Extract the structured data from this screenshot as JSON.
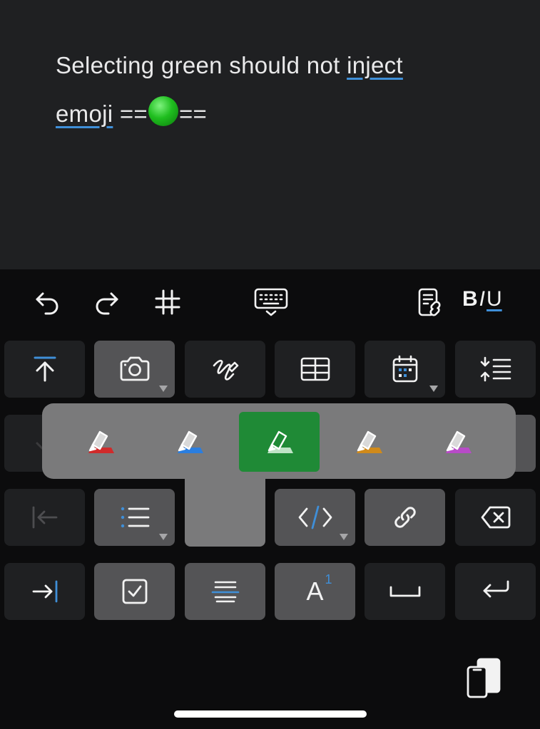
{
  "editor": {
    "line1_prefix": "Selecting green should not ",
    "line1_word": "inject",
    "line2_word": "emoji",
    "line2_mark_open": " ==",
    "line2_mark_close": "=="
  },
  "toolbar": {
    "undo_icon": "undo-icon",
    "redo_icon": "redo-icon",
    "hashtag_icon": "hashtag-icon",
    "keyboard_icon": "keyboard-dismiss-icon",
    "doc_link_icon": "document-link-icon",
    "format": {
      "b": "B",
      "i": "I",
      "u": "U"
    }
  },
  "keys": {
    "superscript": {
      "main": "A",
      "sup": "1"
    }
  },
  "highlighter": {
    "options": [
      {
        "color_name": "red",
        "color": "#d02b2b"
      },
      {
        "color_name": "blue",
        "color": "#2a7ee0"
      },
      {
        "color_name": "green",
        "color": "#1f8a36",
        "selected": true
      },
      {
        "color_name": "orange",
        "color": "#d08a1a"
      },
      {
        "color_name": "purple",
        "color": "#b84bc8"
      }
    ]
  },
  "colors": {
    "accent": "#3f8fd8",
    "selected_highlight": "#1f8a36"
  }
}
